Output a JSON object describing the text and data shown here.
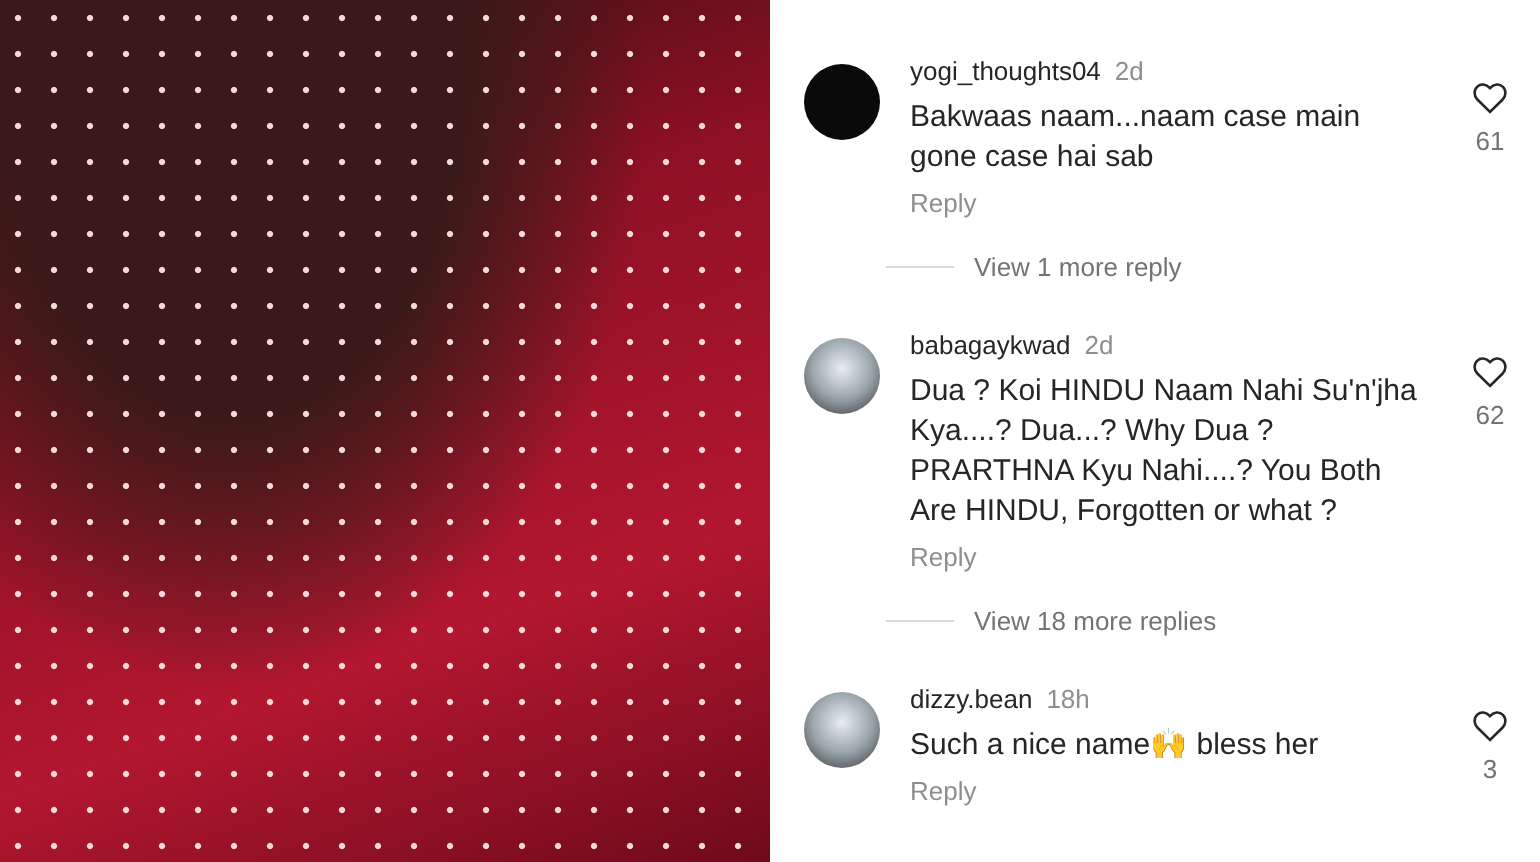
{
  "photo": {
    "kind": "photo"
  },
  "comments": [
    {
      "avatar": {
        "kind": "plain"
      },
      "user": "yogi_thoughts04",
      "time": "2d",
      "text": "Bakwaas naam...naam case main gone case hai sab",
      "likes": "61",
      "reply": "Reply",
      "view_replies": "View 1 more reply"
    },
    {
      "avatar": {
        "kind": "photo"
      },
      "user": "babagaykwad",
      "time": "2d",
      "text": "Dua ? Koi HINDU Naam Nahi Su'n'jha Kya....? Dua...? Why Dua ? PRARTHNA Kyu Nahi....? You Both Are HINDU, Forgotten or what ?",
      "likes": "62",
      "reply": "Reply",
      "view_replies": "View 18 more replies"
    },
    {
      "avatar": {
        "kind": "photo"
      },
      "user": "dizzy.bean",
      "time": "18h",
      "text": "Such a nice name🙌 bless her",
      "likes": "3",
      "reply": "Reply"
    }
  ]
}
